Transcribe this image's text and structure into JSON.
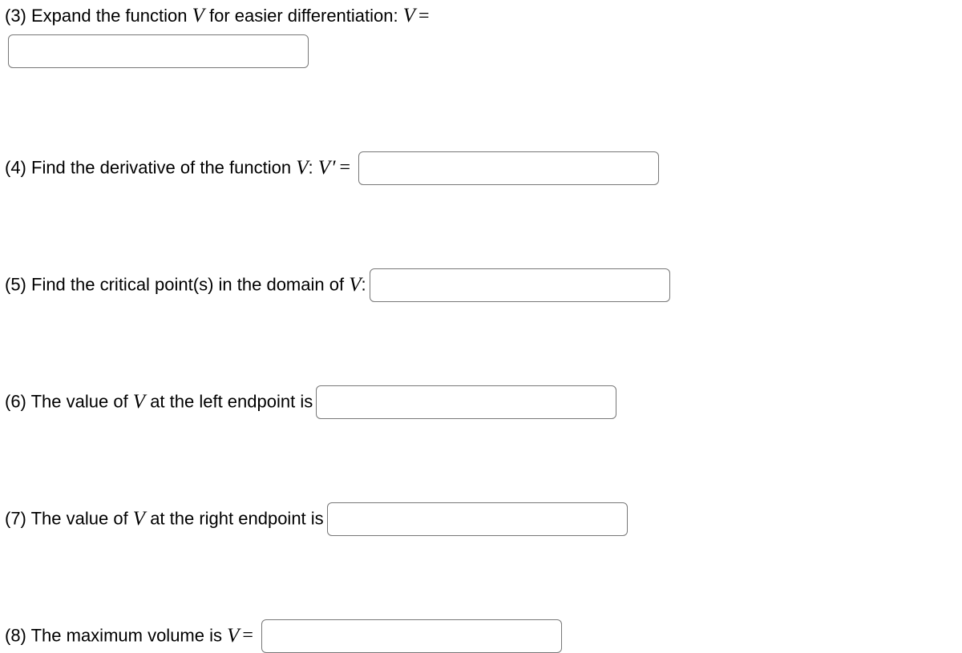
{
  "q3": {
    "pre": "(3) Expand the function ",
    "sym": "V",
    "post": " for easier differentiation: ",
    "lhs": "V",
    "eq": "=",
    "value": ""
  },
  "q4": {
    "pre": "(4) Find the derivative of the function ",
    "sym": "V",
    "sep": ": ",
    "lhs": "V′",
    "eq": "=",
    "value": ""
  },
  "q5": {
    "pre": "(5) Find the critical point(s) in the domain of ",
    "sym": "V",
    "sep": ":",
    "value": ""
  },
  "q6": {
    "pre": "(6) The value of ",
    "sym": "V",
    "post": " at the left endpoint is",
    "value": ""
  },
  "q7": {
    "pre": "(7) The value of ",
    "sym": "V",
    "post": " at the right endpoint is",
    "value": ""
  },
  "q8": {
    "pre": "(8) The maximum volume is ",
    "lhs": "V",
    "eq": "=",
    "value": ""
  }
}
